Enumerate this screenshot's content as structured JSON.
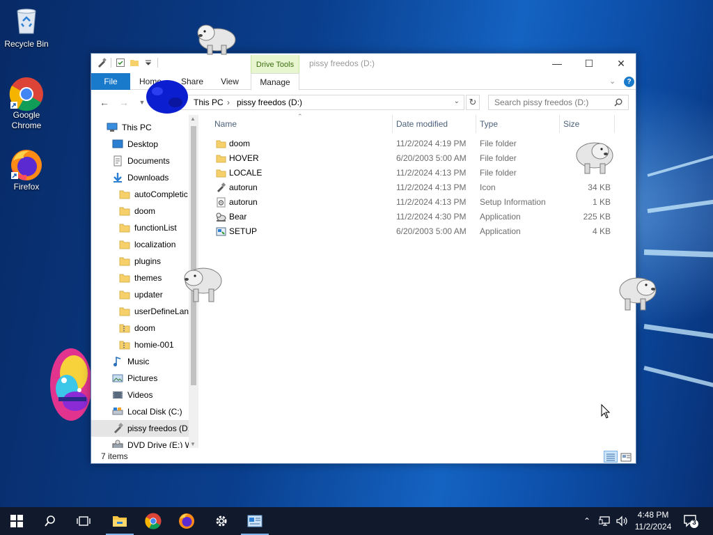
{
  "desktop": {
    "icons": [
      {
        "label": "Recycle Bin"
      },
      {
        "label": "Google Chrome"
      },
      {
        "label": "Firefox"
      }
    ]
  },
  "window": {
    "title": "pissy freedos (D:)",
    "context_group": "Drive Tools",
    "tabs": {
      "file": "File",
      "home": "Home",
      "share": "Share",
      "view": "View",
      "manage": "Manage"
    },
    "controls": {
      "minimize": "—",
      "maximize": "☐",
      "close": "✕"
    }
  },
  "address": {
    "crumbs": [
      "This PC",
      "pissy freedos (D:)"
    ],
    "separator": "›",
    "search_placeholder": "Search pissy freedos (D:)"
  },
  "navpane": {
    "items": [
      {
        "label": "This PC",
        "icon": "pc-icon"
      },
      {
        "label": "Desktop",
        "icon": "desktop-icon"
      },
      {
        "label": "Documents",
        "icon": "documents-icon"
      },
      {
        "label": "Downloads",
        "icon": "downloads-icon"
      },
      {
        "label": "autoCompletic",
        "icon": "folder-icon"
      },
      {
        "label": "doom",
        "icon": "folder-icon"
      },
      {
        "label": "functionList",
        "icon": "folder-icon"
      },
      {
        "label": "localization",
        "icon": "folder-icon"
      },
      {
        "label": "plugins",
        "icon": "folder-icon"
      },
      {
        "label": "themes",
        "icon": "folder-icon"
      },
      {
        "label": "updater",
        "icon": "folder-icon"
      },
      {
        "label": "userDefineLang",
        "icon": "folder-icon"
      },
      {
        "label": "doom",
        "icon": "zip-folder-icon"
      },
      {
        "label": "homie-001",
        "icon": "zip-folder-icon"
      },
      {
        "label": "Music",
        "icon": "music-icon"
      },
      {
        "label": "Pictures",
        "icon": "pictures-icon"
      },
      {
        "label": "Videos",
        "icon": "videos-icon"
      },
      {
        "label": "Local Disk (C:)",
        "icon": "disk-icon"
      },
      {
        "label": "pissy freedos (D:",
        "icon": "usb-drive-icon"
      },
      {
        "label": "DVD Drive (E:) W",
        "icon": "dvd-icon"
      }
    ]
  },
  "columns": {
    "name": "Name",
    "date": "Date modified",
    "type": "Type",
    "size": "Size"
  },
  "files": [
    {
      "name": "doom",
      "date": "11/2/2024 4:19 PM",
      "type": "File folder",
      "size": "",
      "icon": "folder-icon"
    },
    {
      "name": "HOVER",
      "date": "6/20/2003 5:00 AM",
      "type": "File folder",
      "size": "",
      "icon": "folder-icon"
    },
    {
      "name": "LOCALE",
      "date": "11/2/2024 4:13 PM",
      "type": "File folder",
      "size": "",
      "icon": "folder-icon"
    },
    {
      "name": "autorun",
      "date": "11/2/2024 4:13 PM",
      "type": "Icon",
      "size": "34 KB",
      "icon": "usb-icon-file"
    },
    {
      "name": "autorun",
      "date": "11/2/2024 4:13 PM",
      "type": "Setup Information",
      "size": "1 KB",
      "icon": "setup-info-icon"
    },
    {
      "name": "Bear",
      "date": "11/2/2024 4:30 PM",
      "type": "Application",
      "size": "225 KB",
      "icon": "bear-app-icon"
    },
    {
      "name": "SETUP",
      "date": "6/20/2003 5:00 AM",
      "type": "Application",
      "size": "4 KB",
      "icon": "setup-app-icon"
    }
  ],
  "status": {
    "item_count": "7 items"
  },
  "taskbar": {
    "clock_time": "4:48 PM",
    "clock_date": "11/2/2024",
    "notification_count": "3"
  },
  "colors": {
    "accent": "#1979ca",
    "drive_tools_bg": "#e8f6d0",
    "taskbar": "#101a2c"
  }
}
